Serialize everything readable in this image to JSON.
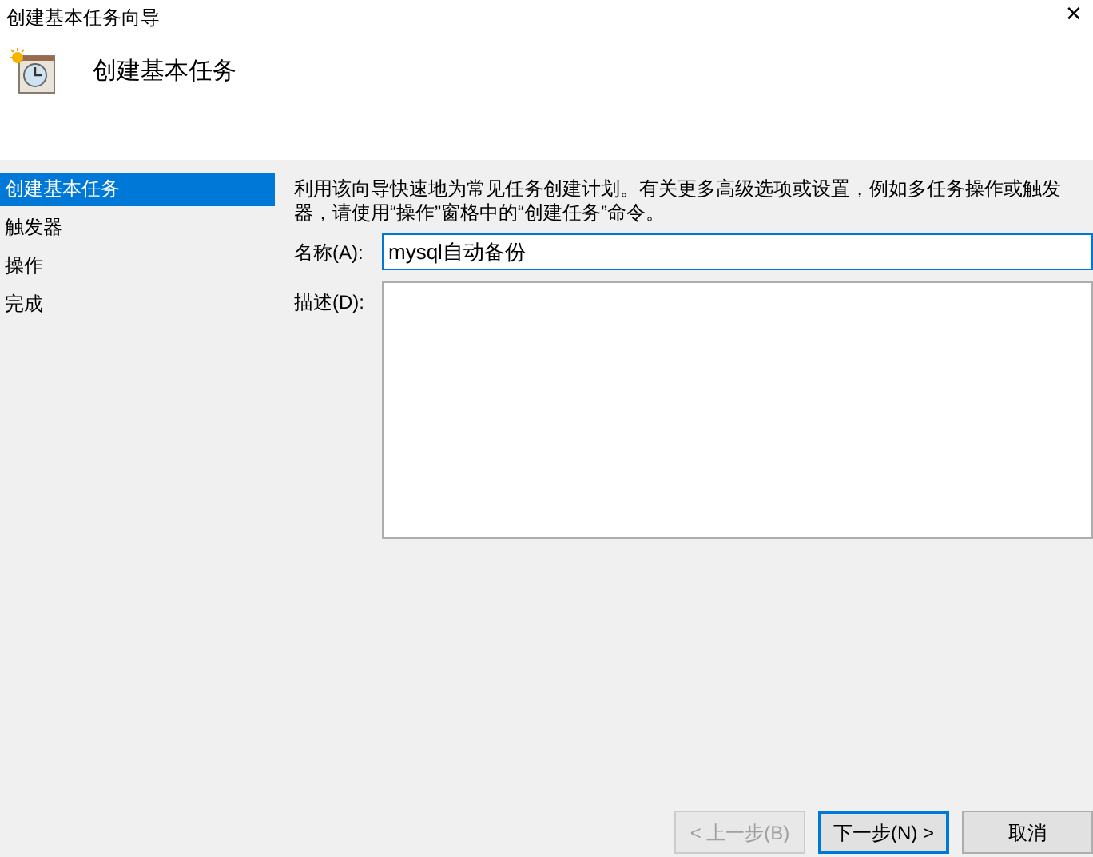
{
  "window": {
    "title": "创建基本任务向导",
    "close": "✕"
  },
  "header": {
    "title": "创建基本任务"
  },
  "sidebar": {
    "items": [
      {
        "label": "创建基本任务",
        "selected": true
      },
      {
        "label": "触发器",
        "selected": false
      },
      {
        "label": "操作",
        "selected": false
      },
      {
        "label": "完成",
        "selected": false
      }
    ]
  },
  "intro": "利用该向导快速地为常见任务创建计划。有关更多高级选项或设置，例如多任务操作或触发器，请使用“操作”窗格中的“创建任务”命令。",
  "name_field": {
    "label": "名称(A):",
    "value": "mysql自动备份"
  },
  "description_field": {
    "label": "描述(D):"
  },
  "buttons": [
    {
      "label": "< 上一步(B)",
      "disabled": true,
      "default": false
    },
    {
      "label": "下一步(N) >",
      "disabled": false,
      "default": true
    },
    {
      "label": "取消",
      "disabled": false,
      "default": false
    }
  ]
}
